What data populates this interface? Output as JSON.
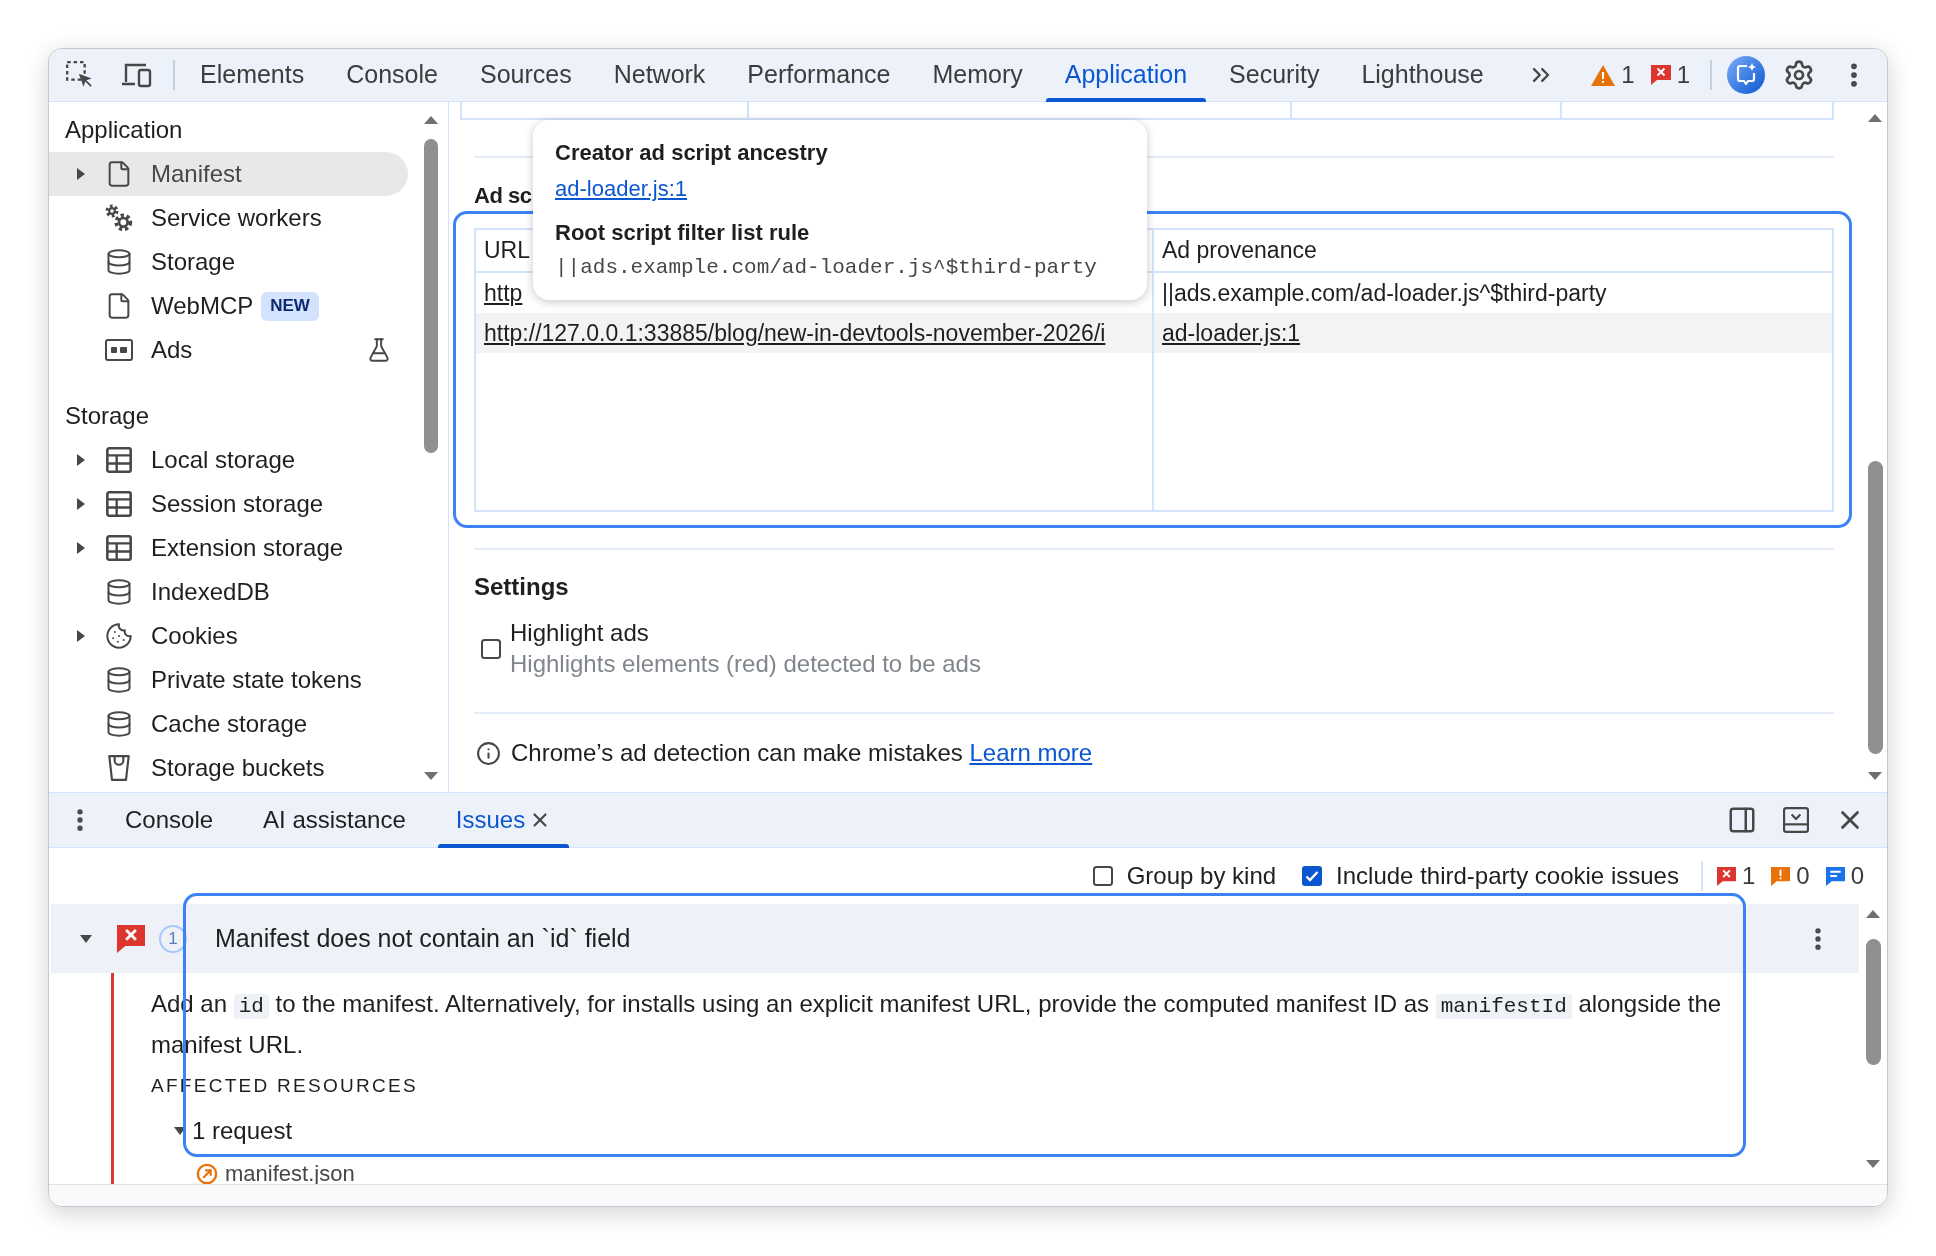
{
  "toolbar": {
    "tabs": [
      {
        "label": "Elements",
        "selected": false
      },
      {
        "label": "Console",
        "selected": false
      },
      {
        "label": "Sources",
        "selected": false
      },
      {
        "label": "Network",
        "selected": false
      },
      {
        "label": "Performance",
        "selected": false
      },
      {
        "label": "Memory",
        "selected": false
      },
      {
        "label": "Application",
        "selected": true
      },
      {
        "label": "Security",
        "selected": false
      },
      {
        "label": "Lighthouse",
        "selected": false
      }
    ],
    "counters": [
      {
        "kind": "warning",
        "count": "1"
      },
      {
        "kind": "error",
        "count": "1"
      }
    ]
  },
  "sidebar": {
    "sections": [
      {
        "title": "Application",
        "items": [
          {
            "label": "Manifest",
            "kind": "document",
            "expanded": false,
            "selected": true
          },
          {
            "label": "Service workers",
            "kind": "workers",
            "selected": false
          },
          {
            "label": "Storage",
            "kind": "database",
            "selected": false
          },
          {
            "label": "WebMCP",
            "kind": "document",
            "selected": false,
            "badge": "NEW"
          },
          {
            "label": "Ads",
            "kind": "ads",
            "selected": false,
            "experimental": true
          }
        ]
      },
      {
        "title": "Storage",
        "items": [
          {
            "label": "Local storage",
            "kind": "table",
            "expanded": false,
            "selected": false
          },
          {
            "label": "Session storage",
            "kind": "table",
            "expanded": false,
            "selected": false
          },
          {
            "label": "Extension storage",
            "kind": "table",
            "expanded": false,
            "selected": false
          },
          {
            "label": "IndexedDB",
            "kind": "database",
            "selected": false
          },
          {
            "label": "Cookies",
            "kind": "cookies",
            "expanded": false,
            "selected": false
          },
          {
            "label": "Private state tokens",
            "kind": "database",
            "selected": false
          },
          {
            "label": "Cache storage",
            "kind": "database",
            "selected": false
          },
          {
            "label": "Storage buckets",
            "kind": "bucket",
            "selected": false
          }
        ]
      }
    ]
  },
  "ad_scripts": {
    "heading": "Ad sc",
    "columns": [
      "URL",
      "Ad provenance"
    ],
    "rows": [
      {
        "url": "http",
        "provenance": {
          "kind": "rule",
          "text": "||ads.example.com/ad-loader.js^$third-party"
        }
      },
      {
        "url": "http://127.0.0.1:33885/blog/new-in-devtools-november-2026/i",
        "provenance": {
          "kind": "link",
          "text": "ad-loader.js:1"
        }
      }
    ]
  },
  "tooltip": {
    "sections": [
      {
        "title": "Creator ad script ancestry",
        "kind": "link",
        "value": "ad-loader.js:1"
      },
      {
        "title": "Root script filter list rule",
        "kind": "code",
        "value": "||ads.example.com/ad-loader.js^$third-party"
      }
    ]
  },
  "settings": {
    "title": "Settings",
    "options": [
      {
        "label": "Highlight ads",
        "description": "Highlights elements (red) detected to be ads",
        "checked": false
      }
    ]
  },
  "notice": {
    "text": "Chrome’s ad detection can make mistakes",
    "link": "Learn more"
  },
  "drawer": {
    "tabs": [
      {
        "label": "Console",
        "selected": false,
        "closable": false
      },
      {
        "label": "AI assistance",
        "selected": false,
        "closable": false
      },
      {
        "label": "Issues",
        "selected": true,
        "closable": true
      }
    ],
    "filters": [
      {
        "label": "Group by kind",
        "checked": false
      },
      {
        "label": "Include third-party cookie issues",
        "checked": true
      }
    ],
    "counters": [
      {
        "kind": "error",
        "count": "1"
      },
      {
        "kind": "warning",
        "count": "0"
      },
      {
        "kind": "info",
        "count": "0"
      }
    ],
    "issues": [
      {
        "kind": "error",
        "count": "1",
        "title": "Manifest does not contain an `id` field",
        "expanded": true,
        "description": [
          {
            "kind": "text",
            "text": "Add an "
          },
          {
            "kind": "code",
            "text": "id"
          },
          {
            "kind": "text",
            "text": " to the manifest. Alternatively, for installs using an explicit manifest URL, provide the computed manifest ID as "
          },
          {
            "kind": "code",
            "text": "manifestId"
          },
          {
            "kind": "text",
            "text": " alongside the manifest URL."
          }
        ],
        "resources_heading": "AFFECTED RESOURCES",
        "resources": [
          {
            "label": "1 request",
            "expanded": true,
            "items": [
              {
                "label": "manifest.json"
              }
            ]
          }
        ]
      }
    ]
  }
}
